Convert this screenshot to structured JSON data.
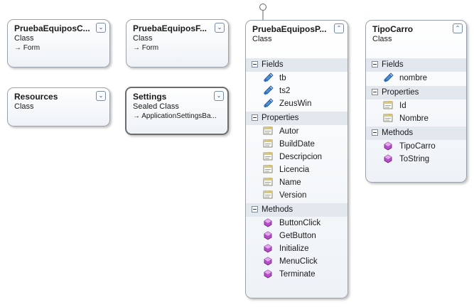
{
  "classes": [
    {
      "name": "PruebaEquiposC...",
      "type": "Class",
      "base": "→ Form",
      "toggle": "⌄"
    },
    {
      "name": "PruebaEquiposF...",
      "type": "Class",
      "base": "→ Form",
      "toggle": "⌄"
    },
    {
      "name": "Resources",
      "type": "Class",
      "toggle": "⌄"
    },
    {
      "name": "Settings",
      "type": "Sealed Class",
      "base": "→ ApplicationSettingsBa...",
      "toggle": "⌄"
    },
    {
      "name": "PruebaEquiposP...",
      "type": "Class",
      "toggle": "⌃",
      "fields_label": "Fields",
      "fields": [
        "tb",
        "ts2",
        "ZeusWin"
      ],
      "properties_label": "Properties",
      "properties": [
        "Autor",
        "BuildDate",
        "Descripcion",
        "Licencia",
        "Name",
        "Version"
      ],
      "methods_label": "Methods",
      "methods": [
        "ButtonClick",
        "GetButton",
        "Initialize",
        "MenuClick",
        "Terminate"
      ]
    },
    {
      "name": "TipoCarro",
      "type": "Class",
      "toggle": "⌃",
      "fields_label": "Fields",
      "fields": [
        "nombre"
      ],
      "properties_label": "Properties",
      "properties": [
        "Id",
        "Nombre"
      ],
      "methods_label": "Methods",
      "methods": [
        "TipoCarro",
        "ToString"
      ]
    }
  ],
  "icons": {
    "field": "field-icon",
    "property": "property-icon",
    "method": "method-icon"
  }
}
